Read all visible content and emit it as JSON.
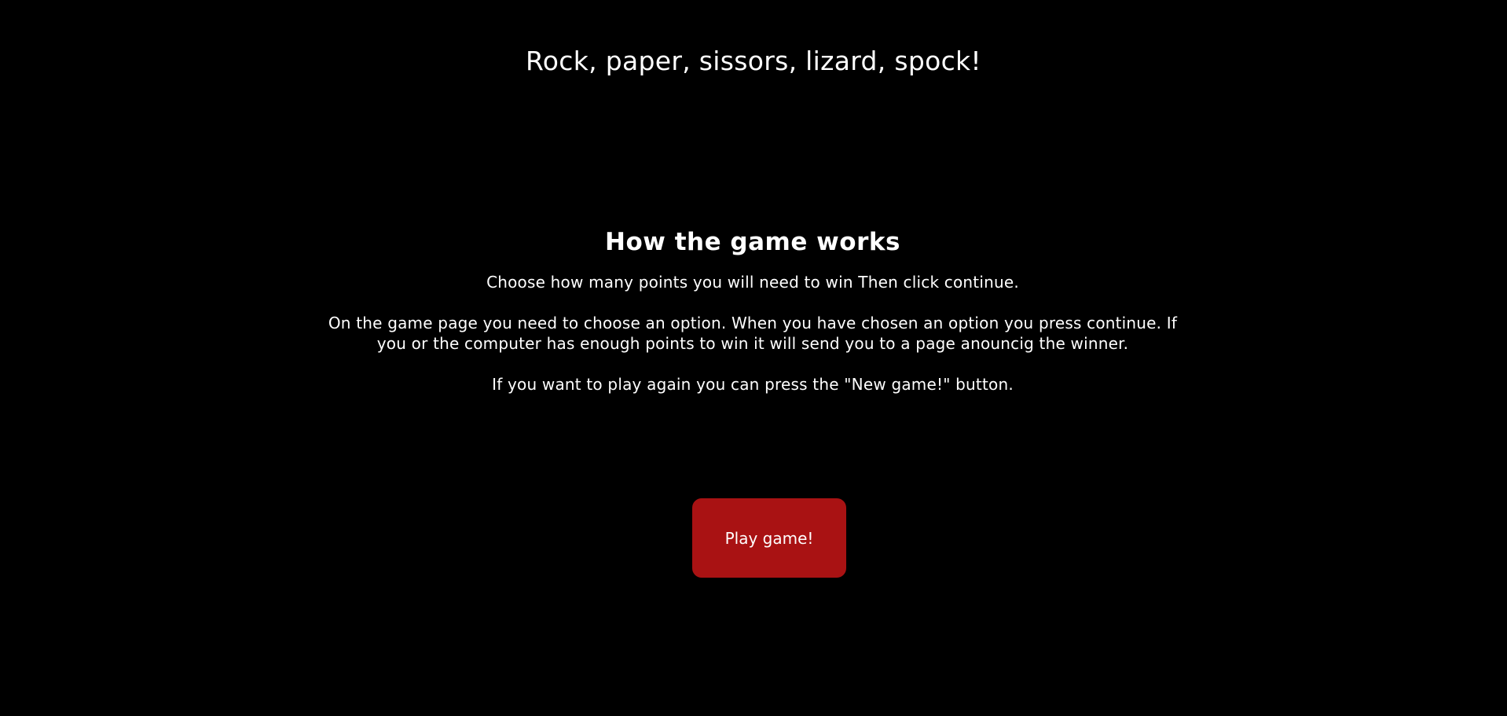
{
  "header": {
    "title": "Rock, paper, sissors, lizard, spock!"
  },
  "instructions": {
    "heading": "How the game works",
    "paragraphs": [
      "Choose how many points you will need to win Then click continue.",
      "On the game page you need to choose an option. When you have chosen an option you press continue. If you or the computer has enough points to win it will send you to a page anouncig the winner.",
      "If you want to play again you can press the \"New game!\" button."
    ]
  },
  "actions": {
    "play_label": "Play game!"
  },
  "colors": {
    "background": "#000000",
    "text": "#ffffff",
    "button": "#a91213"
  }
}
